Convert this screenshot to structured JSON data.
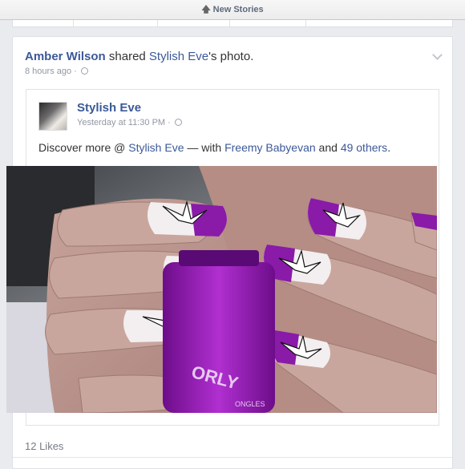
{
  "topbar": {
    "label": "New Stories"
  },
  "post": {
    "actor": "Amber Wilson",
    "verb": " shared ",
    "page": "Stylish Eve",
    "suffix": "'s photo.",
    "time": "8 hours ago · "
  },
  "shared": {
    "name": "Stylish Eve",
    "time": "Yesterday at 11:30 PM · ",
    "desc_prefix": "Discover more @ ",
    "desc_page": "Stylish Eve",
    "desc_mid": " — with ",
    "desc_person": "Freemy Babyevan",
    "desc_and": " and ",
    "desc_others": "49 others",
    "desc_end": "."
  },
  "photo": {
    "polish_brand": "ORLY",
    "polish_cap": "ONGLES"
  },
  "footer": {
    "likes": "12 Likes"
  },
  "icons": [
    "up-arrow-icon",
    "globe-icon",
    "chevron-down-icon"
  ],
  "colors": {
    "link": "#3b5998",
    "polish": "#8a1aa8"
  }
}
